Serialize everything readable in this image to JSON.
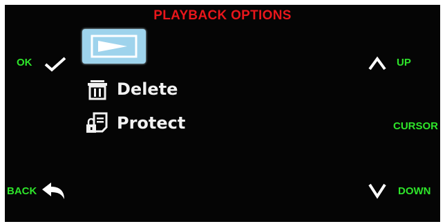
{
  "title": "PLAYBACK OPTIONS",
  "colors": {
    "title": "#e8161b",
    "hint": "#2ee52a",
    "selected_tile": "#9ed3ec",
    "text": "#f2f2f2",
    "background": "#050505"
  },
  "menu": {
    "selected_icon": "playback-icon",
    "items": [
      {
        "label": "Delete",
        "icon": "trash-icon"
      },
      {
        "label": "Protect",
        "icon": "lock-document-icon"
      }
    ]
  },
  "hints": {
    "ok": {
      "label": "OK",
      "icon": "checkmark-icon"
    },
    "back": {
      "label": "BACK",
      "icon": "back-arrow-icon"
    },
    "up": {
      "label": "UP",
      "icon": "chevron-up-icon"
    },
    "down": {
      "label": "DOWN",
      "icon": "chevron-down-icon"
    },
    "cursor": {
      "label": "CURSOR"
    }
  }
}
